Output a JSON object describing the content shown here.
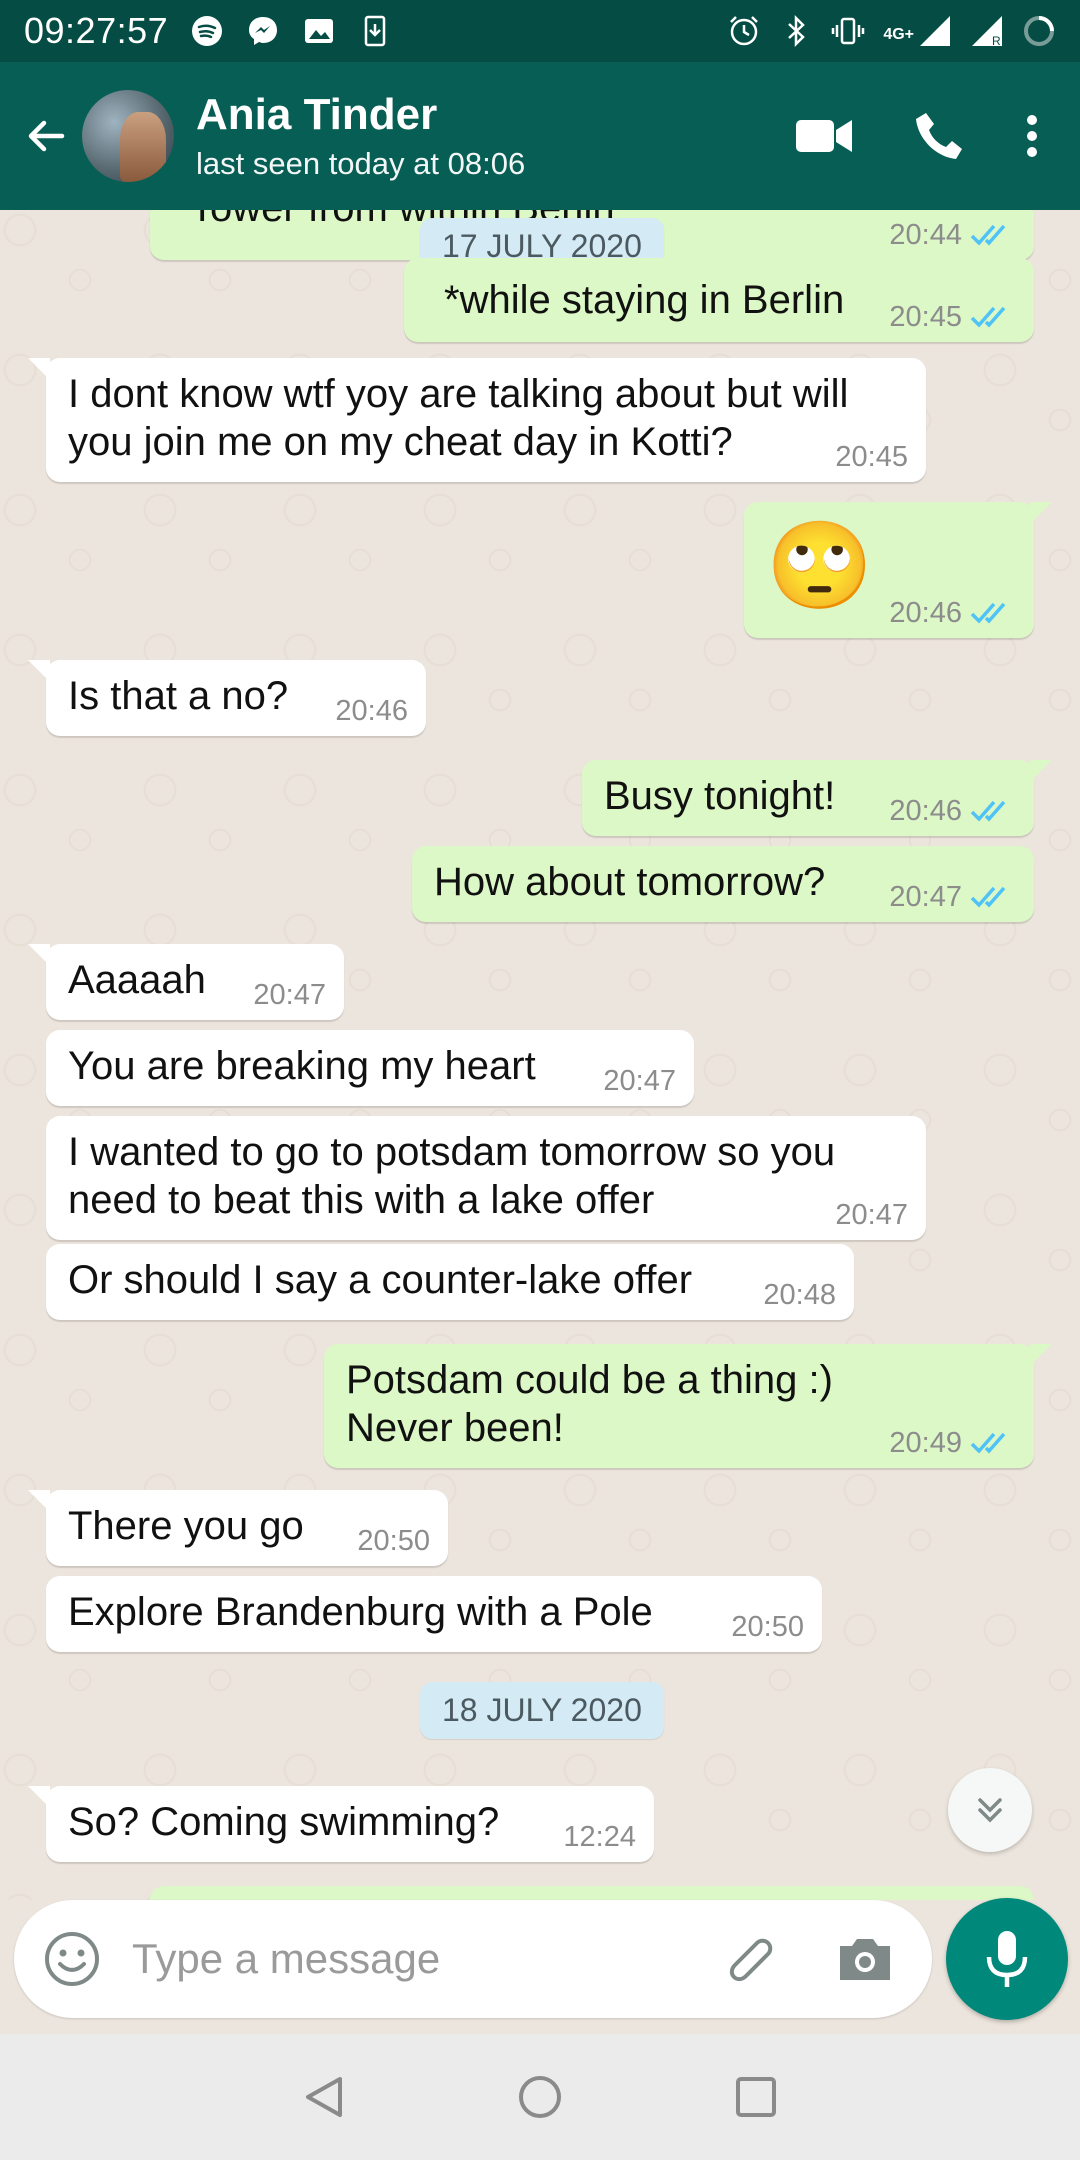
{
  "status_bar": {
    "time": "09:27:57",
    "network": "4G+"
  },
  "header": {
    "contact_name": "Ania Tinder",
    "last_seen": "last seen today at 08:06",
    "back_icon": "arrow-left-icon",
    "video_icon": "video-call-icon",
    "call_icon": "phone-icon",
    "menu_icon": "more-vertical-icon"
  },
  "dates": {
    "first": "17 JULY 2020",
    "second": "18 JULY 2020"
  },
  "messages": [
    {
      "dir": "out",
      "text": "Tower from within Berlin",
      "time": "20:44"
    },
    {
      "dir": "out",
      "text": "*while staying in Berlin",
      "time": "20:45"
    },
    {
      "dir": "in",
      "text": "I dont know wtf yoy are talking about but will you join me on my cheat day in Kotti?",
      "time": "20:45"
    },
    {
      "dir": "out",
      "text": "🙄",
      "time": "20:46"
    },
    {
      "dir": "in",
      "text": "Is that a no?",
      "time": "20:46"
    },
    {
      "dir": "out",
      "text": "Busy tonight!",
      "time": "20:46"
    },
    {
      "dir": "out",
      "text": "How about tomorrow?",
      "time": "20:47"
    },
    {
      "dir": "in",
      "text": "Aaaaah",
      "time": "20:47"
    },
    {
      "dir": "in",
      "text": "You are breaking my heart",
      "time": "20:47"
    },
    {
      "dir": "in",
      "text": "I wanted to go to potsdam tomorrow so you need to beat this with a lake offer",
      "time": "20:47"
    },
    {
      "dir": "in",
      "text": "Or should I say a counter-lake offer",
      "time": "20:48"
    },
    {
      "dir": "out",
      "text": "Potsdam could be a thing :)\nNever been!",
      "time": "20:49"
    },
    {
      "dir": "in",
      "text": "There you go",
      "time": "20:50"
    },
    {
      "dir": "in",
      "text": "Explore Brandenburg with a Pole",
      "time": "20:50"
    },
    {
      "dir": "in",
      "text": "So? Coming swimming?",
      "time": "12:24"
    }
  ],
  "composer": {
    "placeholder": "Type a message"
  },
  "colors": {
    "header": "#075e54",
    "statusbar": "#054d44",
    "outgoing_bubble": "#dcf8c6",
    "incoming_bubble": "#ffffff",
    "read_ticks": "#4fc3f7",
    "mic_button": "#00897b"
  }
}
